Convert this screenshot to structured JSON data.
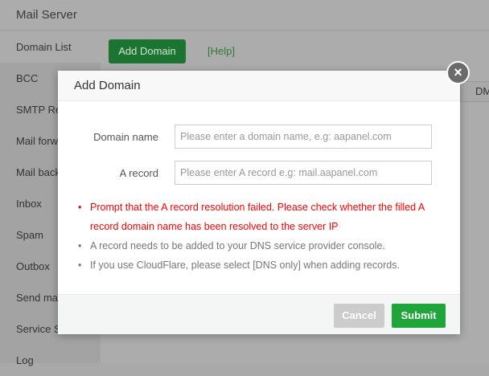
{
  "header": {
    "title": "Mail Server"
  },
  "sidebar": {
    "items": [
      {
        "label": "Domain List",
        "active": true
      },
      {
        "label": "BCC"
      },
      {
        "label": "SMTP Re"
      },
      {
        "label": "Mail forw"
      },
      {
        "label": "Mail back"
      },
      {
        "label": "Inbox"
      },
      {
        "label": "Spam"
      },
      {
        "label": "Outbox"
      },
      {
        "label": "Send mai"
      },
      {
        "label": "Service S"
      },
      {
        "label": "Log"
      }
    ]
  },
  "toolbar": {
    "add_label": "Add Domain",
    "help_label": "[Help]",
    "dm_label": "DM"
  },
  "modal": {
    "title": "Add Domain",
    "close_icon": "close-icon",
    "fields": [
      {
        "label": "Domain name",
        "value": "",
        "placeholder": "Please enter a domain name, e.g: aapanel.com"
      },
      {
        "label": "A record",
        "value": "",
        "placeholder": "Please enter A record e.g: mail.aapanel.com"
      }
    ],
    "tips": [
      "Prompt that the A record resolution failed. Please check whether the filled A record domain name has been resolved to the server IP",
      "A record needs to be added to your DNS service provider console.",
      "If you use CloudFlare, please select [DNS only] when adding records."
    ],
    "cancel_label": "Cancel",
    "submit_label": "Submit"
  },
  "colors": {
    "accent": "#20a53a",
    "error": "#ff0000"
  }
}
